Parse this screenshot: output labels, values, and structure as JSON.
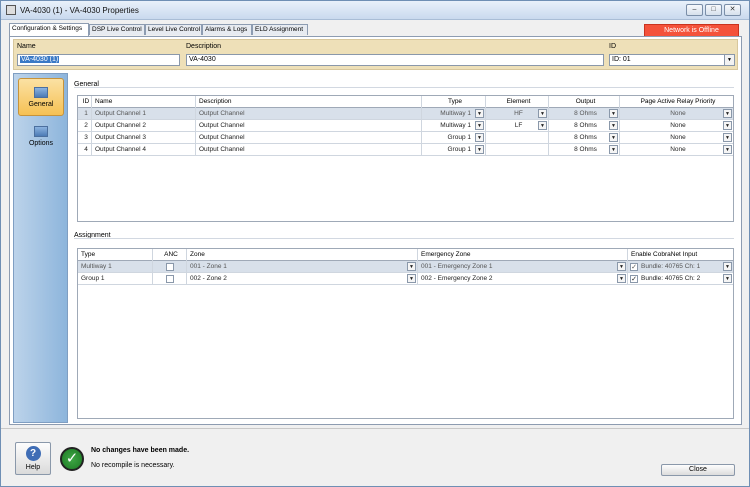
{
  "window": {
    "title": "VA-4030 (1) - VA-4030 Properties",
    "minimize": "–",
    "maximize": "□",
    "close": "✕"
  },
  "tabs": [
    "Configuration & Settings",
    "DSP Live Control",
    "Level Live Control",
    "Alarms & Logs",
    "ELD Assignment"
  ],
  "network_status": "Network is Offline",
  "header": {
    "name_label": "Name",
    "name_value": "VA-4030 (1)",
    "description_label": "Description",
    "description_value": "VA-4030",
    "id_label": "ID",
    "id_value": "ID: 01"
  },
  "sidebar": [
    {
      "label": "General",
      "icon": "general-icon"
    },
    {
      "label": "Options",
      "icon": "options-icon"
    }
  ],
  "general": {
    "section_label": "General",
    "columns": [
      "ID",
      "Name",
      "Description",
      "Type",
      "Element",
      "Output",
      "Page Active Relay Priority"
    ],
    "rows": [
      [
        "1",
        "Output Channel 1",
        "Output Channel",
        "Multiway 1",
        "HF",
        "8 Ohms",
        "None"
      ],
      [
        "2",
        "Output Channel 2",
        "Output Channel",
        "Multiway 1",
        "LF",
        "8 Ohms",
        "None"
      ],
      [
        "3",
        "Output Channel 3",
        "Output Channel",
        "Group 1",
        "",
        "8 Ohms",
        "None"
      ],
      [
        "4",
        "Output Channel 4",
        "Output Channel",
        "Group 1",
        "",
        "8 Ohms",
        "None"
      ]
    ]
  },
  "assignment": {
    "section_label": "Assignment",
    "columns": [
      "Type",
      "ANC",
      "Zone",
      "Emergency Zone",
      "Enable CobraNet Input"
    ],
    "rows": [
      [
        "Multiway 1",
        "",
        "001 - Zone 1",
        "001 - Emergency Zone 1",
        "Bundle: 40765 Ch: 1"
      ],
      [
        "Group 1",
        "",
        "002 - Zone 2",
        "002 - Emergency Zone 2",
        "Bundle: 40765 Ch: 2"
      ]
    ]
  },
  "footer": {
    "help_label": "Help",
    "status_main": "No changes have been made.",
    "status_sub": "No recompile is necessary.",
    "close_label": "Close"
  }
}
